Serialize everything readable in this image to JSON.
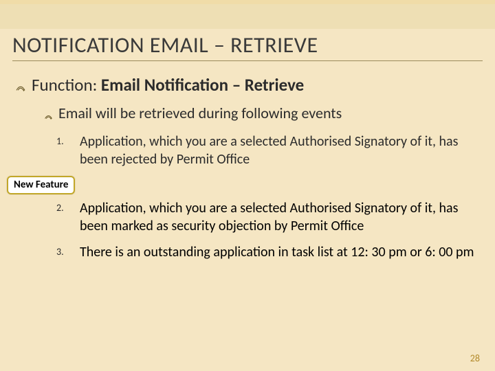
{
  "heading": "NOTIFICATION EMAIL – RETRIEVE",
  "level1": {
    "label": "Function: ",
    "bold": "Email Notification – Retrieve"
  },
  "level2": "Email will be retrieved during following events",
  "items": {
    "n1": {
      "num": "1.",
      "text": "Application, which you are a selected Authorised Signatory of it, has been rejected by Permit Office"
    },
    "n2": {
      "num": "2.",
      "text": "Application, which you are a selected Authorised Signatory of it, has been marked as security objection by Permit Office"
    },
    "n3": {
      "num": "3.",
      "text": "There is an outstanding application in task list at 12: 30 pm or 6: 00 pm"
    }
  },
  "badge": "New Feature",
  "page": "28",
  "colors": {
    "accent": "#b38a2a"
  }
}
